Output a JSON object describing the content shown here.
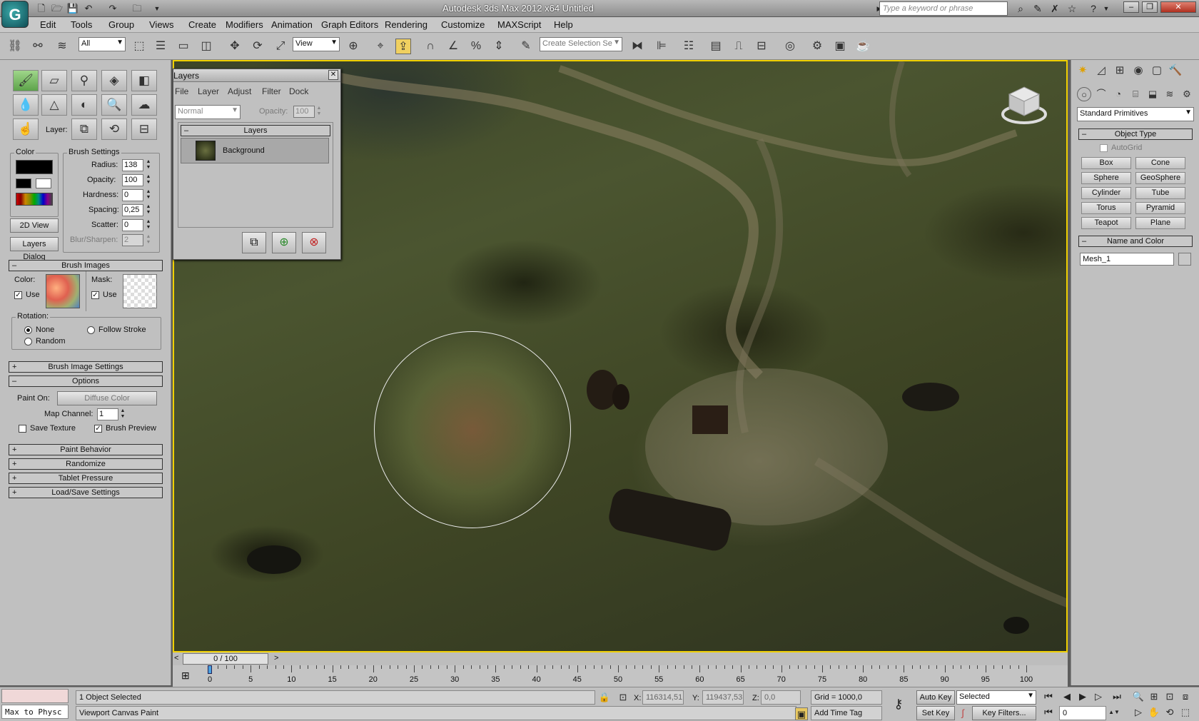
{
  "window": {
    "title": "Autodesk 3ds Max 2012 x64      Untitled",
    "search_placeholder": "Type a keyword or phrase"
  },
  "menu": [
    "Edit",
    "Tools",
    "Group",
    "Views",
    "Create",
    "Modifiers",
    "Animation",
    "Graph Editors",
    "Rendering",
    "Customize",
    "MAXScript",
    "Help"
  ],
  "toolbar": {
    "selection_filter": "All",
    "ref_coord": "View",
    "selection_set_placeholder": "Create Selection Se"
  },
  "canvas_paint": {
    "layer_label": "Layer:",
    "color_group": "Color",
    "brush_settings_group": "Brush Settings",
    "radius_label": "Radius:",
    "radius": "138",
    "opacity_label": "Opacity:",
    "opacity": "100",
    "hardness_label": "Hardness:",
    "hardness": "0",
    "spacing_label": "Spacing:",
    "spacing": "0,25",
    "scatter_label": "Scatter:",
    "scatter": "0",
    "blur_label": "Blur/Sharpen:",
    "blur": "2",
    "view2d_button": "2D View",
    "layers_dialog_button": "Layers Dialog",
    "brush_images": {
      "title": "Brush Images",
      "color_label": "Color:",
      "mask_label": "Mask:",
      "use_label": "Use",
      "rotation_label": "Rotation:",
      "none_label": "None",
      "follow_stroke_label": "Follow Stroke",
      "random_label": "Random"
    },
    "brush_image_settings": "Brush Image Settings",
    "options": {
      "title": "Options",
      "paint_on_label": "Paint On:",
      "paint_on_value": "Diffuse Color",
      "map_channel_label": "Map Channel:",
      "map_channel": "1",
      "save_texture_label": "Save Texture",
      "brush_preview_label": "Brush Preview"
    },
    "paint_behavior": "Paint Behavior",
    "randomize": "Randomize",
    "tablet_pressure": "Tablet Pressure",
    "load_save": "Load/Save Settings"
  },
  "layers_dialog": {
    "title": "Layers",
    "menu": [
      "File",
      "Layer",
      "Adjust",
      "Filter",
      "Dock"
    ],
    "blend_mode": "Normal",
    "opacity_label": "Opacity:",
    "opacity": "100",
    "panel_title": "Layers",
    "layer_name": "Background"
  },
  "command_panel": {
    "category": "Standard Primitives",
    "object_type_title": "Object Type",
    "autogrid_label": "AutoGrid",
    "objects": [
      "Box",
      "Cone",
      "Sphere",
      "GeoSphere",
      "Cylinder",
      "Tube",
      "Torus",
      "Pyramid",
      "Teapot",
      "Plane"
    ],
    "name_color_title": "Name and Color",
    "object_name": "Mesh_1"
  },
  "timeline": {
    "slider_text": "0 / 100",
    "ticks": [
      "0",
      "5",
      "10",
      "15",
      "20",
      "25",
      "30",
      "35",
      "40",
      "45",
      "50",
      "55",
      "60",
      "65",
      "70",
      "75",
      "80",
      "85",
      "90",
      "95",
      "100"
    ]
  },
  "status": {
    "listener_text": "Max to Physc",
    "selection_info": "1 Object Selected",
    "prompt": "Viewport Canvas Paint",
    "x_label": "X:",
    "x_value": "116314,51",
    "y_label": "Y:",
    "y_value": "119437,53",
    "z_label": "Z:",
    "z_value": "0,0",
    "grid": "Grid = 1000,0",
    "add_time_tag": "Add Time Tag",
    "auto_key": "Auto Key",
    "set_key": "Set Key",
    "key_mode": "Selected",
    "key_filters": "Key Filters...",
    "frame": "0"
  },
  "colors": {
    "viewport_border": "#f0d000",
    "active_tool": "#5da34a"
  }
}
